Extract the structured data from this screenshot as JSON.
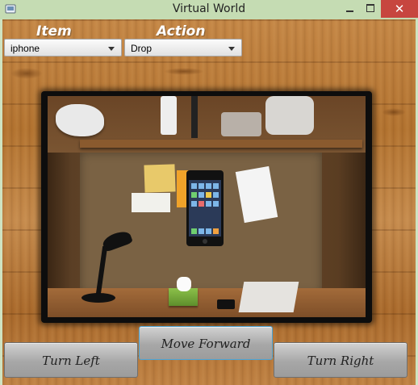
{
  "window": {
    "title": "Virtual World",
    "close_glyph": "✕",
    "icon_name": "app-icon"
  },
  "controls": {
    "item_label": "Item",
    "action_label": "Action",
    "item_select": {
      "value": "iphone"
    },
    "action_select": {
      "value": "Drop"
    }
  },
  "scene": {
    "description_icon": "photo-of-desk-nook-with-iphone"
  },
  "buttons": {
    "turn_left": "Turn Left",
    "move_forward": "Move Forward",
    "turn_right": "Turn Right"
  },
  "colors": {
    "titlebar": "#c5dcb3",
    "close": "#c7463f",
    "wood": "#b97b3b",
    "focus_border": "#4aa4d6"
  }
}
